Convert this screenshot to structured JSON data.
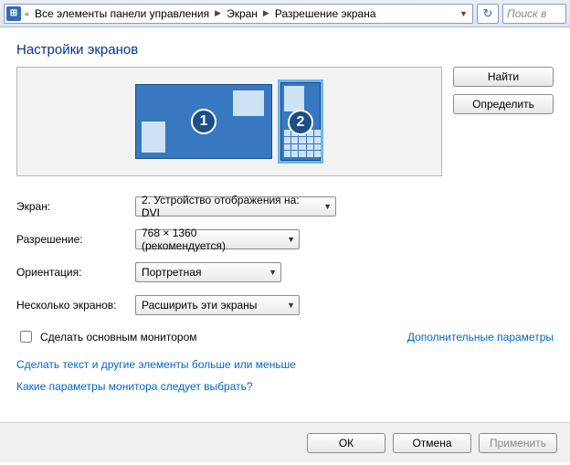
{
  "breadcrumb": {
    "root": "Все элементы панели управления",
    "mid": "Экран",
    "leaf": "Разрешение экрана",
    "search_placeholder": "Поиск в"
  },
  "title": "Настройки экранов",
  "side_buttons": {
    "find": "Найти",
    "identify": "Определить"
  },
  "monitors": {
    "m1": "1",
    "m2": "2"
  },
  "labels": {
    "screen": "Экран:",
    "resolution": "Разрешение:",
    "orientation": "Ориентация:",
    "multi": "Несколько экранов:"
  },
  "values": {
    "screen": "2. Устройство отображения на: DVI",
    "resolution": "768 × 1360 (рекомендуется)",
    "orientation": "Портретная",
    "multi": "Расширить эти экраны"
  },
  "checkbox_label": "Сделать основным монитором",
  "links": {
    "advanced": "Дополнительные параметры",
    "textsize": "Сделать текст и другие элементы больше или меньше",
    "which": "Какие параметры монитора следует выбрать?"
  },
  "footer": {
    "ok": "ОК",
    "cancel": "Отмена",
    "apply": "Применить"
  }
}
